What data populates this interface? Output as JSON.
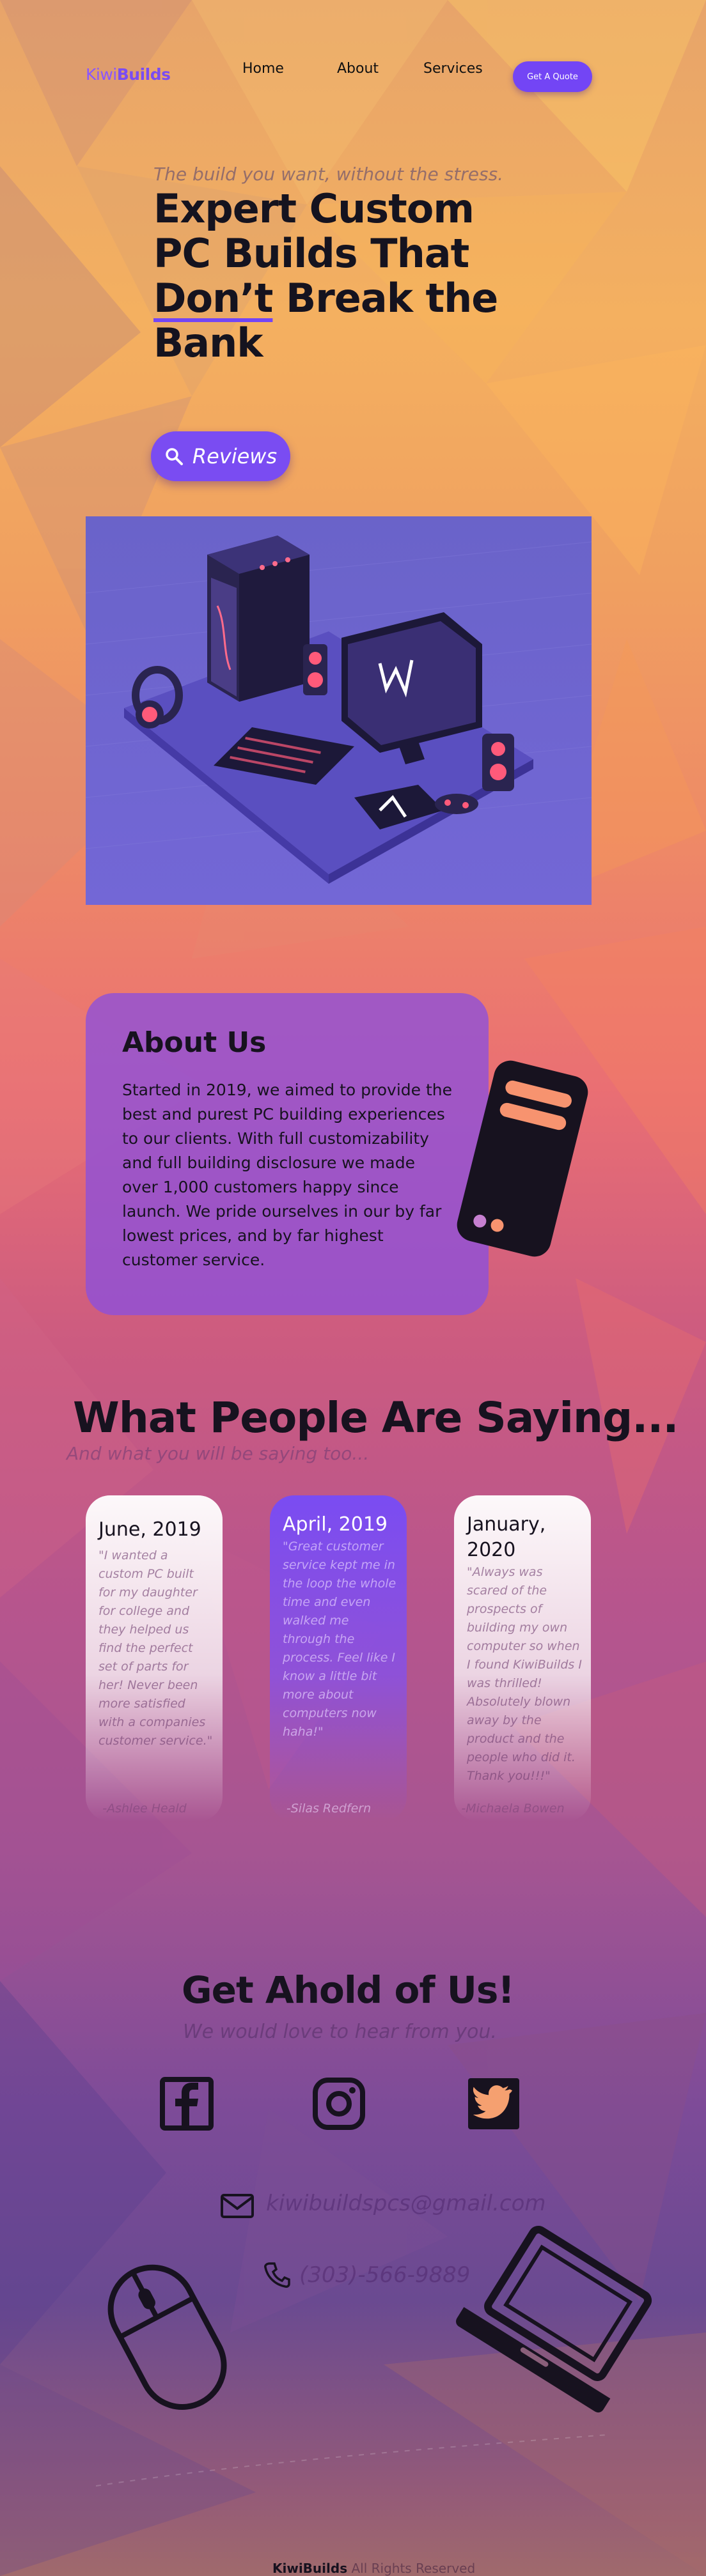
{
  "nav": {
    "logo_part1": "Kiwi",
    "logo_part2": "Builds",
    "links": [
      "Home",
      "About",
      "Services"
    ],
    "cta": "Get A Quote"
  },
  "hero": {
    "tagline": "The build you want, without the stress.",
    "title_line1": "Expert Custom",
    "title_line2": "PC Builds That",
    "title_underlined": "Don’t",
    "title_line3_rest": " Break the",
    "title_line4": "Bank",
    "reviews_button": "Reviews",
    "search_icon": "search-icon"
  },
  "about": {
    "title": "About Us",
    "text": "Started in 2019, we aimed to provide the best and purest PC building experiences to our clients. With full customizability and full building disclosure we made over 1,000 customers happy since launch. We pride ourselves in our by far lowest prices, and by far highest customer service."
  },
  "testimonials": {
    "title": "What People Are Saying...",
    "subtitle": "And what you will be saying too...",
    "items": [
      {
        "date": "June, 2019",
        "quote": "\"I wanted a custom PC built for my daughter for college and they helped us find the perfect set of parts for her! Never been more satisfied with a companies customer service.\"",
        "author": "-Ashlee Heald"
      },
      {
        "date": "April, 2019",
        "quote": "\"Great customer service kept me in the loop the whole time and even walked me through the process. Feel like I know a little bit more about computers now haha!\"",
        "author": "-Silas Redfern"
      },
      {
        "date": "January, 2020",
        "quote": "\"Always was scared of the prospects of building my own computer so when I found KiwiBuilds I was thrilled! Absolutely blown away by the product and the people who did it. Thank you!!!\"",
        "author": "-Michaela Bowen"
      }
    ]
  },
  "contact": {
    "title": "Get Ahold of Us!",
    "subtitle": "We would love to hear from you.",
    "email": "kiwibuildspcs@gmail.com",
    "phone": "(303)-566-9889"
  },
  "footer": {
    "brand": "KiwiBuilds",
    "rights": " All Rights Reserved"
  },
  "colors": {
    "accent": "#7345f5",
    "text_dark": "#17121f"
  }
}
